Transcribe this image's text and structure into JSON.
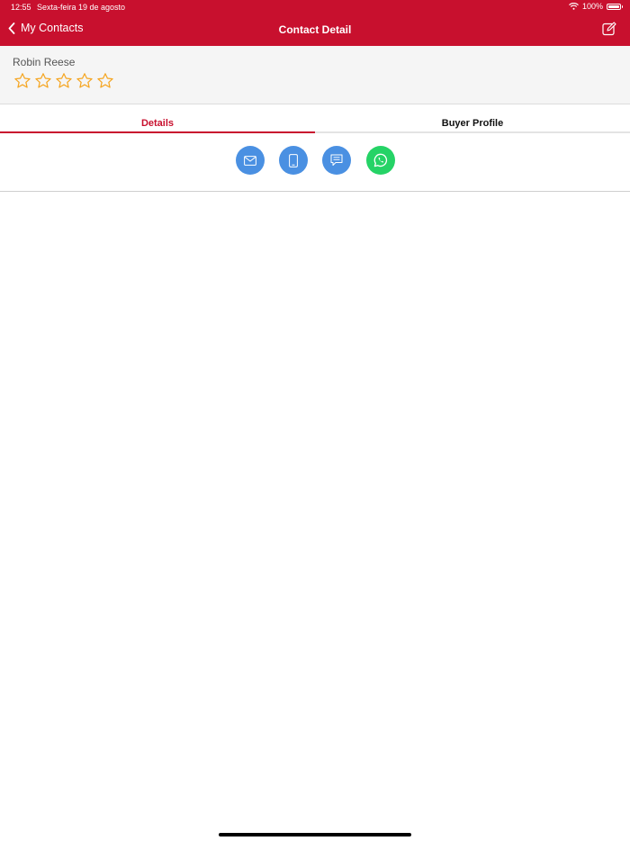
{
  "status_bar": {
    "time": "12:55",
    "date": "Sexta-feira 19 de agosto",
    "battery": "100%"
  },
  "nav": {
    "back_label": "My Contacts",
    "title": "Contact Detail"
  },
  "contact": {
    "name": "Robin Reese",
    "rating": 0,
    "rating_max": 5
  },
  "tabs": [
    {
      "label": "Details",
      "active": true
    },
    {
      "label": "Buyer Profile",
      "active": false
    }
  ],
  "actions": [
    {
      "icon": "email-icon"
    },
    {
      "icon": "phone-icon"
    },
    {
      "icon": "message-icon"
    },
    {
      "icon": "whatsapp-icon"
    }
  ],
  "colors": {
    "brand": "#c8102e",
    "action_blue": "#4a90e2",
    "whatsapp_green": "#25d366",
    "star": "#f5a623"
  }
}
